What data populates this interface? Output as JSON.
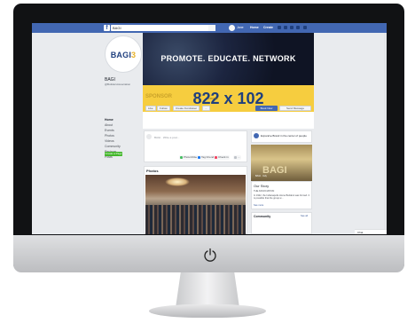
{
  "topbar": {
    "logo_letter": "f",
    "search_value": "BAGI",
    "user_name": "Jane",
    "home_label": "Home",
    "create_label": "Create"
  },
  "sidebar": {
    "logo_main": "BAGI",
    "logo_accent": "3",
    "page_name": "BAGI",
    "page_handle": "@BuildersAssociation",
    "items": [
      {
        "label": "Home",
        "active": true
      },
      {
        "label": "About",
        "active": false
      },
      {
        "label": "Events",
        "active": false
      },
      {
        "label": "Photos",
        "active": false
      },
      {
        "label": "Videos",
        "active": false
      },
      {
        "label": "Community",
        "active": false
      },
      {
        "label": "Reviews",
        "active": false
      },
      {
        "label": "Posts",
        "active": false
      }
    ],
    "create_page_label": "Create a Page"
  },
  "cover": {
    "tagline": "PROMOTE. EDUCATE. NETWORK",
    "sponsor_label": "SPONSOR",
    "dimensions": "822 x 102",
    "size_suffix": "FRAME"
  },
  "actions": {
    "like": "Like",
    "follow": "Follow",
    "fundraiser": "Create Fundraiser",
    "more": "...",
    "book_now": "Book Now",
    "send_message": "Send Message"
  },
  "composer": {
    "prompt_name": "BAGI",
    "prompt_text": "Write a post...",
    "buttons": [
      {
        "label": "Photo/Video",
        "color": "#45bd62"
      },
      {
        "label": "Tag Friends",
        "color": "#1877f2"
      },
      {
        "label": "Check in",
        "color": "#f3425f"
      },
      {
        "label": "...",
        "color": "#bec3c9"
      }
    ]
  },
  "photos": {
    "title": "Photos"
  },
  "right": {
    "expand_text": "Expand ▸ Brand in the center of people",
    "story_logo": "BAGI",
    "story_caption": "BAGI · Indy",
    "our_story": "Our Story",
    "story_heading": "THE ASSOCIATION",
    "story_body": "In 1922, the Indianapolis Home Builders was formed. It is possible that the group w...",
    "see_more": "See more",
    "community_title": "Community",
    "see_all": "See all"
  },
  "chat": {
    "label": "Chat"
  },
  "colors": {
    "fb_blue": "#4267b2",
    "sponsor_yellow": "#f6cd3f",
    "green_button": "#42b72a"
  }
}
